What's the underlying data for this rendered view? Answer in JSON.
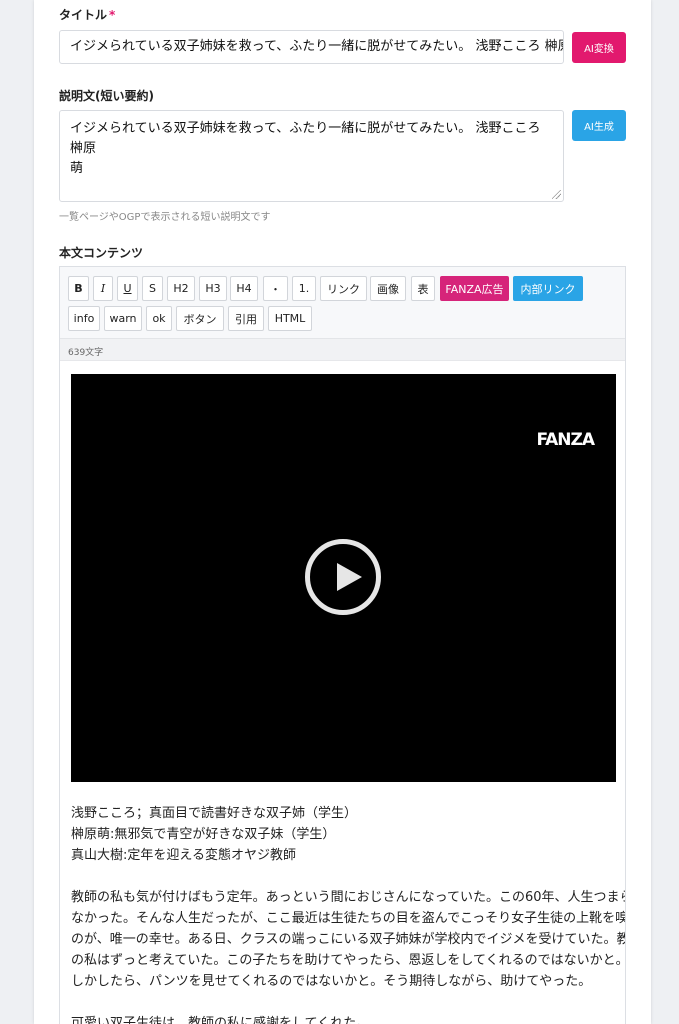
{
  "title_section": {
    "label": "タイトル",
    "required_mark": "*",
    "value": "イジメられている双子姉妹を救って、ふたり一緒に脱がせてみたい。 浅野こころ 榊原萌",
    "ai_button": "AI変換"
  },
  "description_section": {
    "label": "説明文(短い要約)",
    "value_lines": [
      "イジメられている双子姉妹を救って、ふたり一緒に脱がせてみたい。 浅野こころ 榊原",
      "萌"
    ],
    "ai_button": "AI生成",
    "hint": "一覧ページやOGPで表示される短い説明文です"
  },
  "content_section": {
    "label": "本文コンテンツ",
    "toolbar_row1": [
      "B",
      "I",
      "U",
      "S",
      "H2",
      "H3",
      "H4",
      "・",
      "1.",
      "リンク",
      "画像",
      "表",
      "FANZA広告",
      "内部リンク"
    ],
    "toolbar_row2": [
      "info",
      "warn",
      "ok",
      "ボタン",
      "引用",
      "HTML"
    ],
    "char_count": "639文字",
    "video": {
      "logo_text": "FANZA",
      "play_icon": "play-circle-icon"
    },
    "paragraphs": [
      [
        "浅野こころ；真面目で読書好きな双子姉（学生）",
        "榊原萌:無邪気で青空が好きな双子妹（学生）",
        "真山大樹:定年を迎える変態オヤジ教師"
      ],
      [
        "教師の私も気が付けばもう定年。あっという間におじさんになっていた。この60年、人生つまら",
        "なかった。そんな人生だったが、ここ最近は生徒たちの目を盗んでこっそり女子生徒の上靴を嗅ぐ",
        "のが、唯一の幸せ。ある日、クラスの端っこにいる双子姉妹が学校内でイジメを受けていた。教師",
        "の私はずっと考えていた。この子たちを助けてやったら、恩返しをしてくれるのではないかと。も",
        "しかしたら、パンツを見せてくれるのではないかと。そう期待しながら、助けてやった。"
      ],
      [
        "可愛い双子生徒は、教師の私に感謝をしてくれた。"
      ]
    ]
  },
  "colors": {
    "ai_convert": "#e2196e",
    "ai_generate": "#2aa4e6",
    "fanza_ad": "#d6247a",
    "internal_link": "#2aa4e6"
  }
}
